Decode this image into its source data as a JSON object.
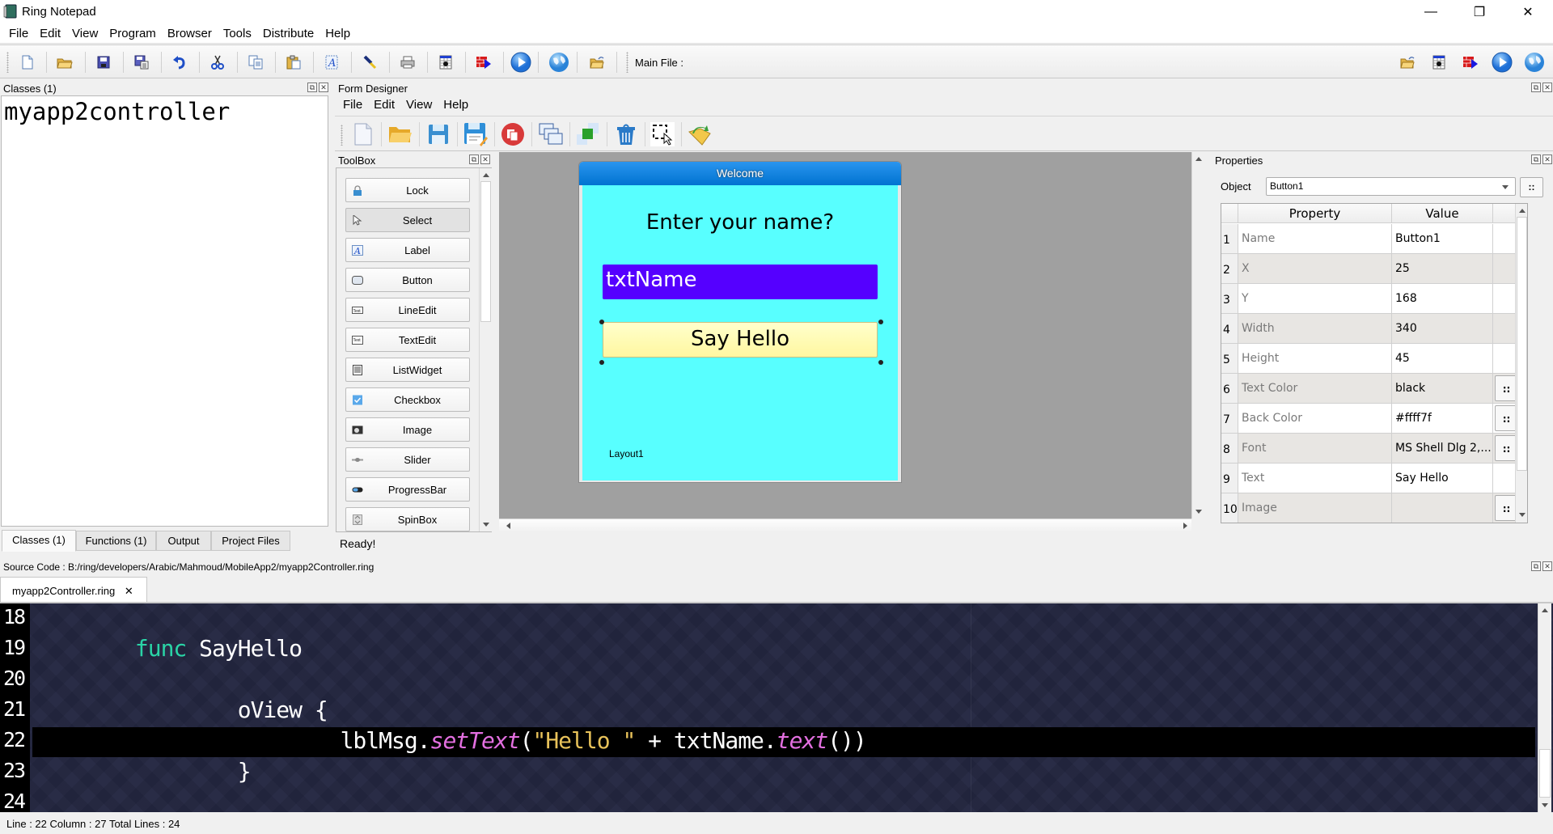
{
  "window": {
    "title": "Ring Notepad",
    "controls": {
      "minimize": "—",
      "maximize": "❐",
      "close": "✕"
    }
  },
  "menubar": [
    "File",
    "Edit",
    "View",
    "Program",
    "Browser",
    "Tools",
    "Distribute",
    "Help"
  ],
  "toolbar": {
    "icons": [
      "new-file-icon",
      "open-folder-icon",
      "save-icon",
      "save-as-icon",
      "undo-icon",
      "cut-icon",
      "copy-icon",
      "paste-icon",
      "font-icon",
      "debug-icon",
      "print-icon",
      "run-gui-icon",
      "distribute-icon",
      "run-icon",
      "web-browser-icon",
      "set-mainfile-icon"
    ],
    "main_file_label": "Main File :",
    "right_icons": [
      "open-mainfile-folder-icon",
      "run-mainfile-gui-icon",
      "distribute-mainfile-icon",
      "run-mainfile-icon",
      "web-mainfile-icon"
    ]
  },
  "classes_panel": {
    "title": "Classes (1)",
    "items": [
      "myapp2controller"
    ]
  },
  "bottom_tabs": [
    {
      "label": "Classes (1)",
      "active": true
    },
    {
      "label": "Functions (1)",
      "active": false
    },
    {
      "label": "Output",
      "active": false
    },
    {
      "label": "Project Files",
      "active": false
    }
  ],
  "form_designer": {
    "title": "Form Designer",
    "menu": [
      "File",
      "Edit",
      "View",
      "Help"
    ],
    "toolbar_icons": [
      "new-form-icon",
      "open-form-icon",
      "save-form-icon",
      "save-form-as-icon",
      "close-form-icon",
      "duplicate-icon",
      "bring-to-front-icon",
      "delete-icon",
      "select-objects-icon",
      "load-icon"
    ],
    "status": "Ready!"
  },
  "toolbox": {
    "title": "ToolBox",
    "items": [
      {
        "label": "Lock",
        "icon": "lock-icon",
        "selected": false
      },
      {
        "label": "Select",
        "icon": "pointer-icon",
        "selected": true
      },
      {
        "label": "Label",
        "icon": "label-icon",
        "selected": false
      },
      {
        "label": "Button",
        "icon": "button-icon",
        "selected": false
      },
      {
        "label": "LineEdit",
        "icon": "lineedit-icon",
        "selected": false
      },
      {
        "label": "TextEdit",
        "icon": "textedit-icon",
        "selected": false
      },
      {
        "label": "ListWidget",
        "icon": "listwidget-icon",
        "selected": false
      },
      {
        "label": "Checkbox",
        "icon": "checkbox-icon",
        "selected": false
      },
      {
        "label": "Image",
        "icon": "image-icon",
        "selected": false
      },
      {
        "label": "Slider",
        "icon": "slider-icon",
        "selected": false
      },
      {
        "label": "ProgressBar",
        "icon": "progressbar-icon",
        "selected": false
      },
      {
        "label": "SpinBox",
        "icon": "spinbox-icon",
        "selected": false
      }
    ]
  },
  "designed_form": {
    "title": "Welcome",
    "background": "#58ffff",
    "prompt_label": "Enter your name?",
    "textbox_text": "txtName",
    "textbox_color": "#5500ff",
    "button_text": "Say Hello",
    "button_color": "#ffff7f",
    "layout_label": "Layout1"
  },
  "properties": {
    "title": "Properties",
    "object_label": "Object",
    "object_value": "Button1",
    "more_button": "::",
    "columns": [
      "Property",
      "Value"
    ],
    "rows": [
      {
        "num": "1",
        "name": "Name",
        "value": "Button1",
        "has_button": false
      },
      {
        "num": "2",
        "name": "X",
        "value": "25",
        "has_button": false
      },
      {
        "num": "3",
        "name": "Y",
        "value": "168",
        "has_button": false
      },
      {
        "num": "4",
        "name": "Width",
        "value": "340",
        "has_button": false
      },
      {
        "num": "5",
        "name": "Height",
        "value": "45",
        "has_button": false
      },
      {
        "num": "6",
        "name": "Text Color",
        "value": "black",
        "has_button": true
      },
      {
        "num": "7",
        "name": "Back Color",
        "value": "#ffff7f",
        "has_button": true
      },
      {
        "num": "8",
        "name": "Font",
        "value": "MS Shell Dlg 2,...",
        "has_button": true
      },
      {
        "num": "9",
        "name": "Text",
        "value": "Say Hello",
        "has_button": false
      },
      {
        "num": "10",
        "name": "Image",
        "value": "",
        "has_button": true
      }
    ]
  },
  "source_code": {
    "title": "Source Code : B:/ring/developers/Arabic/Mahmoud/MobileApp2/myapp2Controller.ring",
    "tab_label": "myapp2Controller.ring",
    "tab_close": "✕",
    "lines": [
      {
        "num": "18",
        "indent": "",
        "tokens": []
      },
      {
        "num": "19",
        "indent": "        ",
        "tokens": [
          {
            "t": "func",
            "c": "kw"
          },
          {
            "t": " SayHello",
            "c": ""
          }
        ]
      },
      {
        "num": "20",
        "indent": "",
        "tokens": []
      },
      {
        "num": "21",
        "indent": "                ",
        "tokens": [
          {
            "t": "oView {",
            "c": ""
          }
        ]
      },
      {
        "num": "22",
        "indent": "                        ",
        "tokens": [
          {
            "t": "lblMsg.",
            "c": ""
          },
          {
            "t": "setText",
            "c": "fn"
          },
          {
            "t": "(",
            "c": ""
          },
          {
            "t": "\"Hello \"",
            "c": "str"
          },
          {
            "t": " + txtName.",
            "c": ""
          },
          {
            "t": "text",
            "c": "fn"
          },
          {
            "t": "())",
            "c": ""
          }
        ],
        "current": true
      },
      {
        "num": "23",
        "indent": "                ",
        "tokens": [
          {
            "t": "}",
            "c": ""
          }
        ]
      },
      {
        "num": "24",
        "indent": "",
        "tokens": []
      }
    ]
  },
  "statusbar": "Line : 22 Column : 27 Total Lines : 24",
  "dock_controls": {
    "float": "⧉",
    "close": "✕"
  }
}
